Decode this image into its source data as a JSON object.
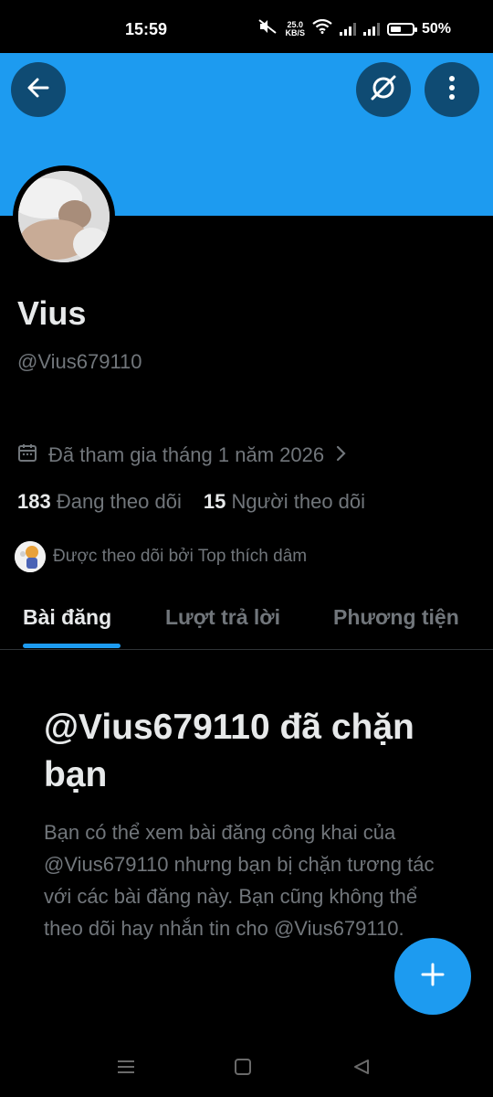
{
  "status_bar": {
    "time": "15:59",
    "net_speed_value": "25.0",
    "net_speed_unit": "KB/S",
    "battery": "50%",
    "battery_level": 0.5
  },
  "header": {
    "back_icon": "arrow-left-icon",
    "grok_icon": "slashed-circle-icon",
    "more_icon": "vertical-dots-icon",
    "banner_color": "#1d9bf0"
  },
  "profile": {
    "name": "Vius",
    "handle": "@Vius679110",
    "joined": "Đã tham gia tháng 1 năm 2026",
    "following_count": "183",
    "following_label": "Đang theo dõi",
    "followers_count": "15",
    "followers_label": "Người theo dõi",
    "followed_by": "Được theo dõi bởi Top thích dâm"
  },
  "tabs": [
    {
      "label": "Bài đăng",
      "active": true
    },
    {
      "label": "Lượt trả lời",
      "active": false
    },
    {
      "label": "Phương tiện",
      "active": false
    }
  ],
  "blocked": {
    "title": "@Vius679110 đã chặn bạn",
    "body": "Bạn có thể xem bài đăng công khai của @Vius679110 nhưng bạn bị chặn tương tác với các bài đăng này. Bạn cũng không thể theo dõi hay nhắn tin cho @Vius679110."
  },
  "fab": {
    "icon": "plus-icon"
  },
  "nav": {
    "icons": [
      "menu-icon",
      "home-square-icon",
      "back-triangle-icon"
    ]
  },
  "colors": {
    "accent": "#1d9bf0",
    "muted": "#71767b",
    "text": "#e7e9ea",
    "background": "#000000"
  }
}
